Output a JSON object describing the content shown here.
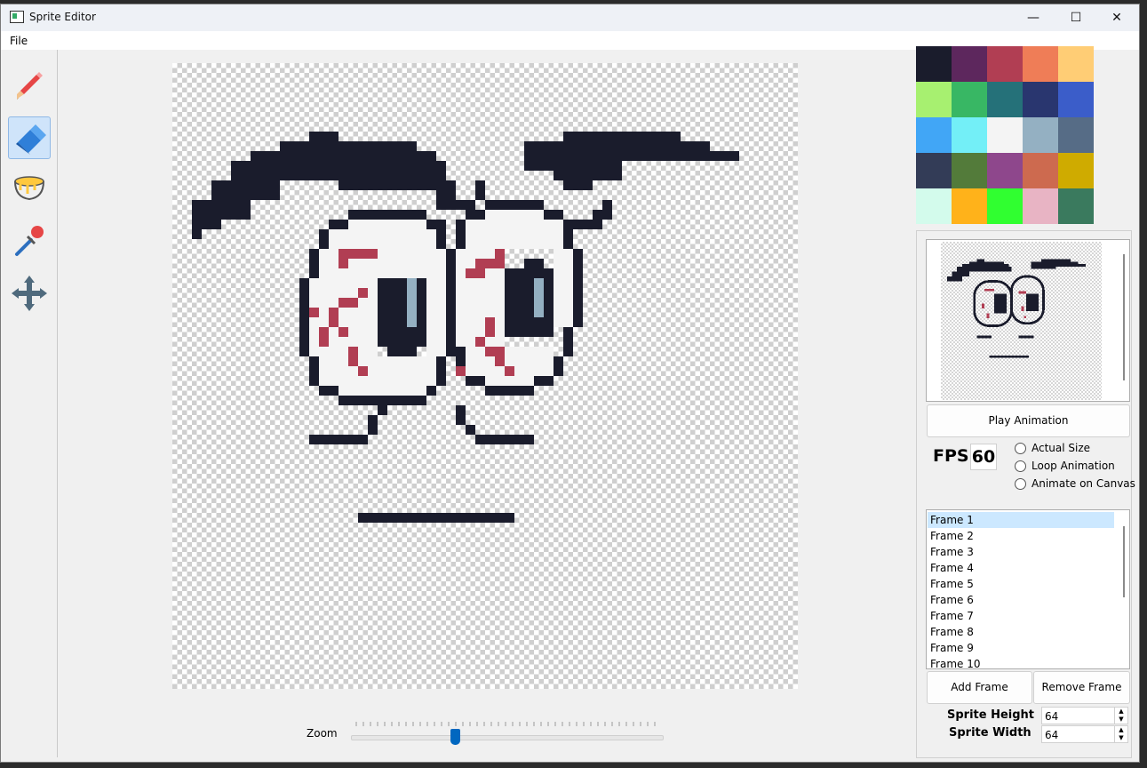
{
  "window": {
    "title": "Sprite Editor",
    "minimize": "—",
    "maximize": "☐",
    "close": "✕"
  },
  "menu": {
    "file": "File"
  },
  "tools": [
    {
      "name": "pencil-tool",
      "icon": "pencil-icon",
      "active": false
    },
    {
      "name": "eraser-tool",
      "icon": "eraser-icon",
      "active": true
    },
    {
      "name": "fill-tool",
      "icon": "bucket-icon",
      "active": false
    },
    {
      "name": "eyedropper-tool",
      "icon": "eyedropper-icon",
      "active": false
    },
    {
      "name": "move-tool",
      "icon": "move-icon",
      "active": false
    }
  ],
  "canvas": {
    "zoom_label": "Zoom",
    "zoom_fraction": 0.33
  },
  "palette": [
    "#1a1c2c",
    "#5d275d",
    "#b13e53",
    "#ef7d57",
    "#ffcd75",
    "#a7f070",
    "#38b764",
    "#257179",
    "#29366f",
    "#3b5dc9",
    "#41a6f6",
    "#73eff7",
    "#f4f4f4",
    "#94b0c2",
    "#566c86",
    "#333c57",
    "#537b3a",
    "#8e478c",
    "#cd6a4f",
    "#cfab00",
    "#d3fbec",
    "#ffb21a",
    "#30ff30",
    "#e8b4c4",
    "#3a7a5e"
  ],
  "preview": {},
  "animation": {
    "play_label": "Play Animation",
    "fps_label": "FPS",
    "fps_value": "60",
    "options": [
      "Actual Size",
      "Loop Animation",
      "Animate on Canvas"
    ]
  },
  "frames": {
    "items": [
      "Frame 1",
      "Frame 2",
      "Frame 3",
      "Frame 4",
      "Frame 5",
      "Frame 6",
      "Frame 7",
      "Frame 8",
      "Frame 9",
      "Frame 10"
    ],
    "selected_index": 0,
    "add_label": "Add Frame",
    "remove_label": "Remove Frame"
  },
  "sprite": {
    "height_label": "Sprite Height",
    "width_label": "Sprite Width",
    "height_value": "64",
    "width_value": "64"
  }
}
